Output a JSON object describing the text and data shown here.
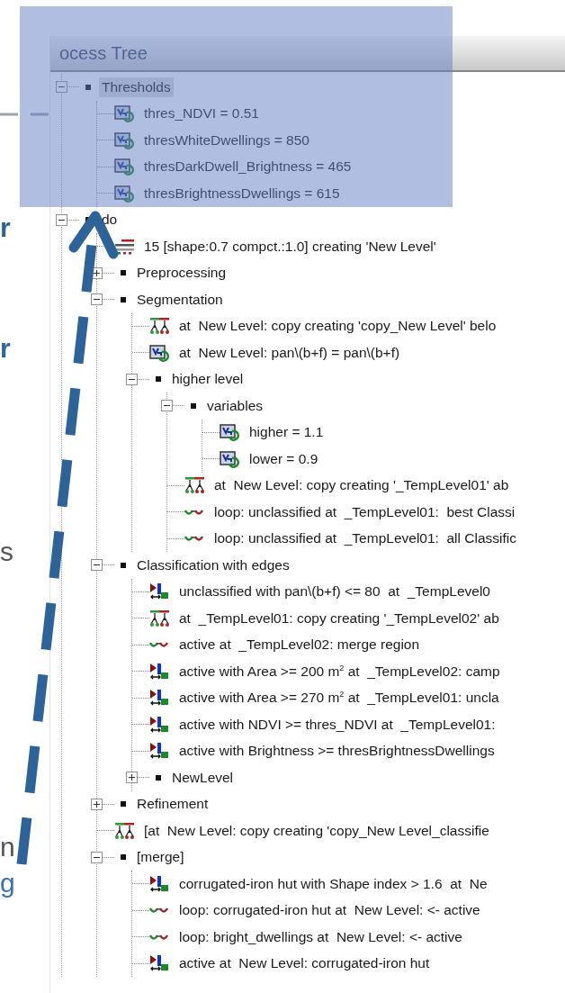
{
  "slide_fragments": [
    {
      "text": "r",
      "color": "#2f6497",
      "bold": true
    },
    {
      "text": "r",
      "color": "#2f6497",
      "bold": true
    },
    {
      "text": "s",
      "color": "#555555",
      "bold": false
    },
    {
      "text": "n",
      "color": "#555555",
      "bold": false
    },
    {
      "text": "g",
      "color": "#3a72b0",
      "bold": false
    }
  ],
  "panel": {
    "title": "ocess Tree"
  },
  "tree": [
    {
      "kind": "group",
      "label": "Thresholds",
      "expanded": true,
      "selected": true,
      "children": [
        {
          "kind": "variable",
          "label": "thres_NDVI = 0.51",
          "selected": false
        },
        {
          "kind": "variable",
          "label": "thresWhiteDwellings = 850",
          "selected": false
        },
        {
          "kind": "variable",
          "label": "thresDarkDwell_Brightness = 465",
          "selected": false
        },
        {
          "kind": "variable",
          "label": "thresBrightnessDwellings = 615",
          "selected": false
        }
      ]
    },
    {
      "kind": "group",
      "label": "do",
      "expanded": true,
      "selected": false,
      "children": [
        {
          "kind": "segmentation",
          "label": "15 [shape:0.7 compct.:1.0] creating 'New Level'",
          "selected": false
        },
        {
          "kind": "group",
          "label": "Preprocessing",
          "expanded": false,
          "selected": false
        },
        {
          "kind": "group",
          "label": "Segmentation",
          "expanded": true,
          "selected": false,
          "children": [
            {
              "kind": "copy",
              "label": "at  New Level: copy creating 'copy_New Level' belo",
              "selected": false
            },
            {
              "kind": "variable",
              "label": "at  New Level: pan\\(b+f) = pan\\(b+f)",
              "selected": false
            },
            {
              "kind": "group",
              "label": "higher level",
              "expanded": true,
              "selected": false,
              "children": [
                {
                  "kind": "group",
                  "label": "variables",
                  "expanded": true,
                  "selected": false,
                  "children": [
                    {
                      "kind": "variable",
                      "label": "higher = 1.1",
                      "selected": false
                    },
                    {
                      "kind": "variable",
                      "label": "lower = 0.9",
                      "selected": false
                    }
                  ]
                },
                {
                  "kind": "copy",
                  "label": "at  New Level: copy creating '_TempLevel01' ab",
                  "selected": false
                },
                {
                  "kind": "loop",
                  "label": "loop: unclassified at  _TempLevel01:  best Classi",
                  "selected": false
                },
                {
                  "kind": "loop",
                  "label": "loop: unclassified at  _TempLevel01:  all Classific",
                  "selected": false
                }
              ]
            }
          ]
        },
        {
          "kind": "group",
          "label": "Classification with edges",
          "expanded": true,
          "selected": false,
          "children": [
            {
              "kind": "classify",
              "label": "unclassified with pan\\(b+f) <= 80  at  _TempLevel0",
              "selected": false
            },
            {
              "kind": "copy",
              "label": "at  _TempLevel01: copy creating '_TempLevel02' ab",
              "selected": false
            },
            {
              "kind": "loop",
              "label": "active at  _TempLevel02: merge region",
              "selected": false
            },
            {
              "kind": "classify",
              "label": "active with Area >= 200 m$^{2}$ at  _TempLevel02: camp",
              "selected": false
            },
            {
              "kind": "classify",
              "label": "active with Area >= 270 m$^{2}$ at  _TempLevel01: uncla",
              "selected": false
            },
            {
              "kind": "classify",
              "label": "active with NDVI >= thres_NDVI at  _TempLevel01:",
              "selected": false
            },
            {
              "kind": "classify",
              "label": "active with Brightness >= thresBrightnessDwellings",
              "selected": false
            },
            {
              "kind": "group",
              "label": "NewLevel",
              "expanded": false,
              "selected": false
            }
          ]
        },
        {
          "kind": "group",
          "label": "Refinement",
          "expanded": false,
          "selected": false
        },
        {
          "kind": "copy",
          "label": "[at  New Level: copy creating 'copy_New Level_classifie",
          "selected": false
        },
        {
          "kind": "group",
          "label": "[merge]",
          "expanded": true,
          "selected": false,
          "children": [
            {
              "kind": "classify",
              "label": "corrugated-iron hut with Shape index > 1.6  at  Ne",
              "selected": false
            },
            {
              "kind": "loop",
              "label": "loop: corrugated-iron hut at  New Level: <- active",
              "selected": false
            },
            {
              "kind": "loop",
              "label": "loop: bright_dwellings at  New Level: <- active",
              "selected": false
            },
            {
              "kind": "classify",
              "label": "active at  New Level: corrugated-iron hut",
              "selected": false
            }
          ]
        }
      ]
    }
  ]
}
